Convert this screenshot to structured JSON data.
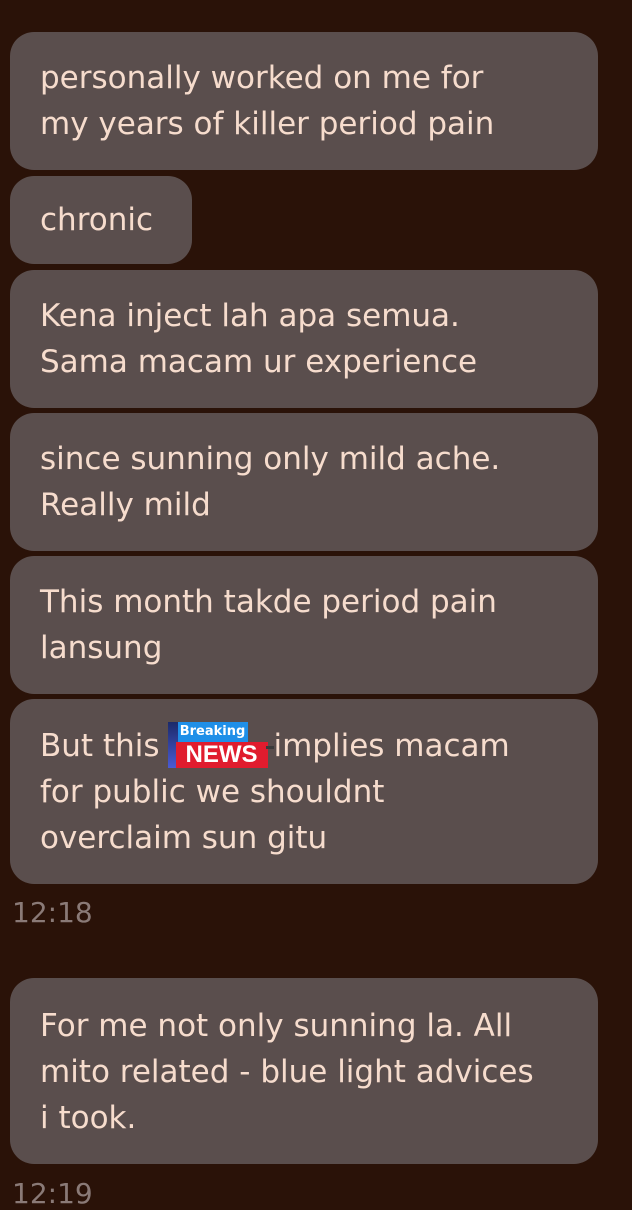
{
  "messages": [
    {
      "lines": [
        "personally worked on me for",
        "my years of killer period pain"
      ]
    },
    {
      "lines": [
        "chronic"
      ]
    },
    {
      "lines": [
        "Kena inject lah apa semua.",
        "Sama macam ur experience"
      ]
    },
    {
      "lines": [
        "since sunning only mild ache.",
        "Really mild"
      ]
    },
    {
      "lines": [
        "This month takde period pain",
        "lansung"
      ]
    },
    {
      "line1_before": "But this",
      "line1_after": "implies macam",
      "lines_rest": [
        "for public we shouldnt",
        "overclaim sun gitu"
      ],
      "sticker": {
        "top_text": "Breaking",
        "main_text": "NEWS"
      }
    },
    {
      "lines": [
        "For me not only sunning la. All",
        "mito related - blue light advices",
        "i took."
      ]
    }
  ],
  "timestamps": [
    "12:18",
    "12:19"
  ],
  "colors": {
    "background": "#2a1208",
    "bubble": "#5a4e4d",
    "text": "#f6dccd",
    "timestamp": "#8a7a77"
  }
}
